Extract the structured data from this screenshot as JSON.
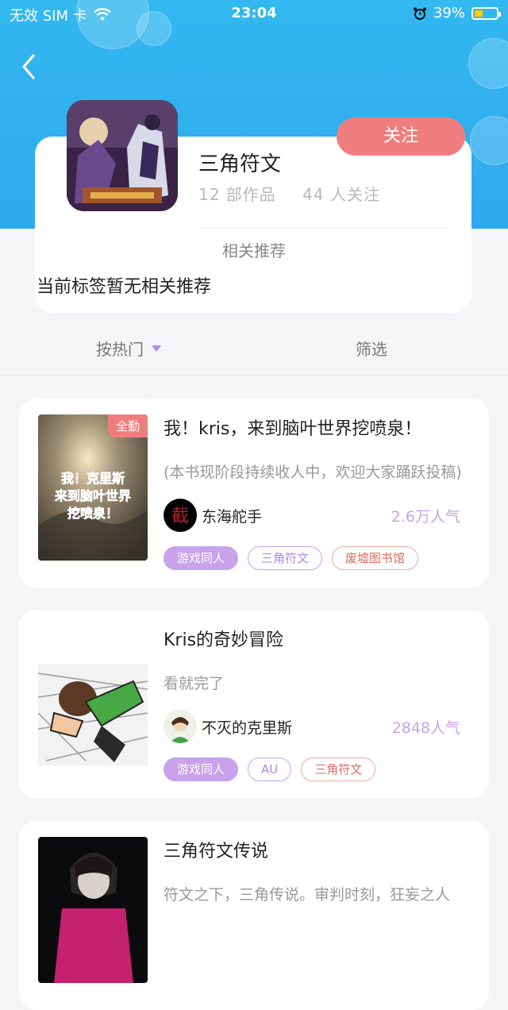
{
  "status_bar": {
    "carrier": "无效 SIM 卡",
    "time": "23:04",
    "battery_percent": "39%",
    "battery_level": 0.39
  },
  "colors": {
    "header": "#33b8ef",
    "follow": "#f07d7e",
    "accent_purple": "#c8a2ea",
    "accent_red": "#e06b63"
  },
  "tag": {
    "name": "三角符文",
    "works": "12 部作品",
    "followers": "44 人关注",
    "follow_label": "关注"
  },
  "recommend": {
    "title": "相关推荐",
    "empty_text": "当前标签暂无相关推荐"
  },
  "filters": {
    "sort_label": "按热门",
    "filter_label": "筛选"
  },
  "books": [
    {
      "title": "我！kris，来到脑叶世界挖喷泉！",
      "desc": "(本书现阶段持续收人中，欢迎大家踊跃投稿)",
      "author": "东海舵手",
      "popularity": "2.6万人气",
      "badge": "全勤",
      "cover_text": "我！克里斯\n来到脑叶世界\n挖喷泉！",
      "avatar_char": "截",
      "tags": [
        "游戏同人",
        "三角符文",
        "废墟图书馆"
      ]
    },
    {
      "title": "Kris的奇妙冒险",
      "desc": "看就完了",
      "author": "不灭的克里斯",
      "popularity": "2848人气",
      "tags": [
        "游戏同人",
        "AU",
        "三角符文"
      ]
    },
    {
      "title": "三角符文传说",
      "desc": "符文之下，三角传说。审判时刻，狂妄之人",
      "author": "",
      "popularity": "",
      "tags": []
    }
  ]
}
